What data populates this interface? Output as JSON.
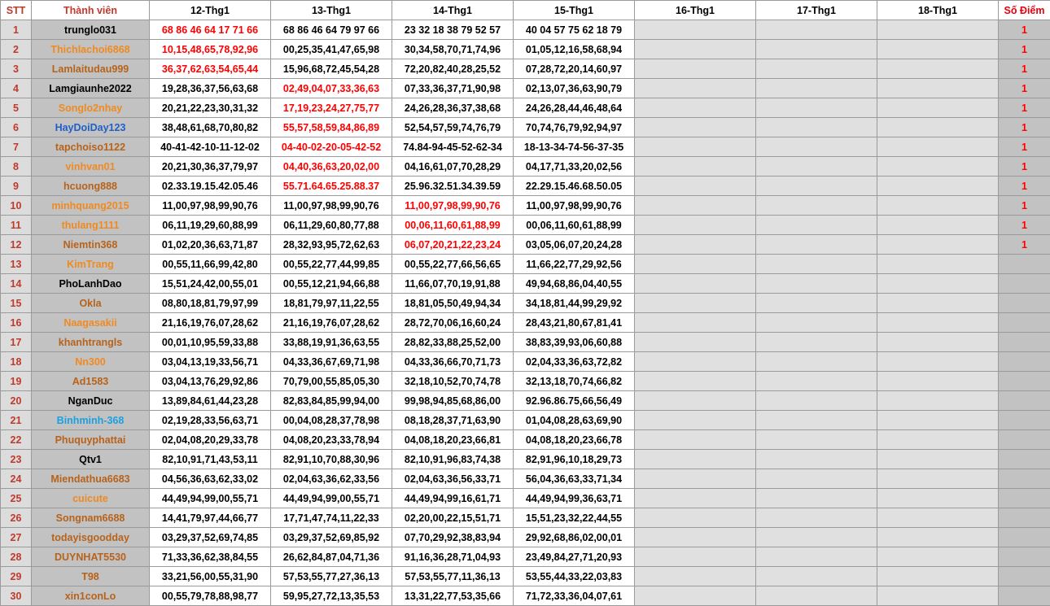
{
  "headers": {
    "stt": "STT",
    "member": "Thành viên",
    "days": [
      "12-Thg1",
      "13-Thg1",
      "14-Thg1",
      "15-Thg1",
      "16-Thg1",
      "17-Thg1",
      "18-Thg1"
    ],
    "score": "Số Điểm"
  },
  "colors": {
    "header_red": "#c0392b",
    "highlight_red": "#ff0000",
    "orange_name": "#f08a20",
    "brown_name": "#b8621a",
    "blue_name": "#2060c8",
    "lightblue_name": "#1aa0e0",
    "member_bg": "#c2c2c2",
    "empty_bg": "#e0e0e0"
  },
  "rows": [
    {
      "stt": "1",
      "member": "trunglo031",
      "name_color": "#000000",
      "days": [
        "68 86 46 64 17 71 66",
        "68 86 46 64 79 97 66",
        "23 32 18 38 79 52 57",
        "40 04 57 75 62 18 79",
        "",
        "",
        ""
      ],
      "win_day": 0,
      "score": "1"
    },
    {
      "stt": "2",
      "member": "Thichlachoi6868",
      "name_color": "#f08a20",
      "days": [
        "10,15,48,65,78,92,96",
        "00,25,35,41,47,65,98",
        "30,34,58,70,71,74,96",
        "01,05,12,16,58,68,94",
        "",
        "",
        ""
      ],
      "win_day": 0,
      "score": "1"
    },
    {
      "stt": "3",
      "member": "Lamlaitudau999",
      "name_color": "#b8621a",
      "days": [
        "36,37,62,63,54,65,44",
        "15,96,68,72,45,54,28",
        "72,20,82,40,28,25,52",
        "07,28,72,20,14,60,97",
        "",
        "",
        ""
      ],
      "win_day": 0,
      "score": "1"
    },
    {
      "stt": "4",
      "member": "Lamgiaunhe2022",
      "name_color": "#000000",
      "days": [
        "19,28,36,37,56,63,68",
        "02,49,04,07,33,36,63",
        "07,33,36,37,71,90,98",
        "02,13,07,36,63,90,79",
        "",
        "",
        ""
      ],
      "win_day": 1,
      "score": "1"
    },
    {
      "stt": "5",
      "member": "Songlo2nhay",
      "name_color": "#f08a20",
      "days": [
        "20,21,22,23,30,31,32",
        "17,19,23,24,27,75,77",
        "24,26,28,36,37,38,68",
        "24,26,28,44,46,48,64",
        "",
        "",
        ""
      ],
      "win_day": 1,
      "score": "1"
    },
    {
      "stt": "6",
      "member": "HayDoiDay123",
      "name_color": "#2060c8",
      "days": [
        "38,48,61,68,70,80,82",
        "55,57,58,59,84,86,89",
        "52,54,57,59,74,76,79",
        "70,74,76,79,92,94,97",
        "",
        "",
        ""
      ],
      "win_day": 1,
      "score": "1"
    },
    {
      "stt": "7",
      "member": "tapchoiso1122",
      "name_color": "#b8621a",
      "days": [
        "40-41-42-10-11-12-02",
        "04-40-02-20-05-42-52",
        "74.84-94-45-52-62-34",
        "18-13-34-74-56-37-35",
        "",
        "",
        ""
      ],
      "win_day": 1,
      "score": "1"
    },
    {
      "stt": "8",
      "member": "vinhvan01",
      "name_color": "#f08a20",
      "days": [
        "20,21,30,36,37,79,97",
        "04,40,36,63,20,02,00",
        "04,16,61,07,70,28,29",
        "04,17,71,33,20,02,56",
        "",
        "",
        ""
      ],
      "win_day": 1,
      "score": "1"
    },
    {
      "stt": "9",
      "member": "hcuong888",
      "name_color": "#b8621a",
      "days": [
        "02.33.19.15.42.05.46",
        "55.71.64.65.25.88.37",
        "25.96.32.51.34.39.59",
        "22.29.15.46.68.50.05",
        "",
        "",
        ""
      ],
      "win_day": 1,
      "score": "1"
    },
    {
      "stt": "10",
      "member": "minhquang2015",
      "name_color": "#f08a20",
      "days": [
        "11,00,97,98,99,90,76",
        "11,00,97,98,99,90,76",
        "11,00,97,98,99,90,76",
        "11,00,97,98,99,90,76",
        "",
        "",
        ""
      ],
      "win_day": 2,
      "score": "1"
    },
    {
      "stt": "11",
      "member": "thulang1111",
      "name_color": "#f08a20",
      "days": [
        "06,11,19,29,60,88,99",
        "06,11,29,60,80,77,88",
        "00,06,11,60,61,88,99",
        "00,06,11,60,61,88,99",
        "",
        "",
        ""
      ],
      "win_day": 2,
      "score": "1"
    },
    {
      "stt": "12",
      "member": "Niemtin368",
      "name_color": "#b8621a",
      "days": [
        "01,02,20,36,63,71,87",
        "28,32,93,95,72,62,63",
        "06,07,20,21,22,23,24",
        "03,05,06,07,20,24,28",
        "",
        "",
        ""
      ],
      "win_day": 2,
      "score": "1"
    },
    {
      "stt": "13",
      "member": "KimTrang",
      "name_color": "#f08a20",
      "days": [
        "00,55,11,66,99,42,80",
        "00,55,22,77,44,99,85",
        "00,55,22,77,66,56,65",
        "11,66,22,77,29,92,56",
        "",
        "",
        ""
      ],
      "win_day": -1,
      "score": ""
    },
    {
      "stt": "14",
      "member": "PhoLanhDao",
      "name_color": "#000000",
      "days": [
        "15,51,24,42,00,55,01",
        "00,55,12,21,94,66,88",
        "11,66,07,70,19,91,88",
        "49,94,68,86,04,40,55",
        "",
        "",
        ""
      ],
      "win_day": -1,
      "score": ""
    },
    {
      "stt": "15",
      "member": "Okla",
      "name_color": "#b8621a",
      "days": [
        "08,80,18,81,79,97,99",
        "18,81,79,97,11,22,55",
        "18,81,05,50,49,94,34",
        "34,18,81,44,99,29,92",
        "",
        "",
        ""
      ],
      "win_day": -1,
      "score": ""
    },
    {
      "stt": "16",
      "member": "Naagasakii",
      "name_color": "#f08a20",
      "days": [
        "21,16,19,76,07,28,62",
        "21,16,19,76,07,28,62",
        "28,72,70,06,16,60,24",
        "28,43,21,80,67,81,41",
        "",
        "",
        ""
      ],
      "win_day": -1,
      "score": ""
    },
    {
      "stt": "17",
      "member": "khanhtrangls",
      "name_color": "#b8621a",
      "days": [
        "00,01,10,95,59,33,88",
        "33,88,19,91,36,63,55",
        "28,82,33,88,25,52,00",
        "38,83,39,93,06,60,88",
        "",
        "",
        ""
      ],
      "win_day": -1,
      "score": ""
    },
    {
      "stt": "18",
      "member": "Nn300",
      "name_color": "#f08a20",
      "days": [
        "03,04,13,19,33,56,71",
        "04,33,36,67,69,71,98",
        "04,33,36,66,70,71,73",
        "02,04,33,36,63,72,82",
        "",
        "",
        ""
      ],
      "win_day": -1,
      "score": ""
    },
    {
      "stt": "19",
      "member": "Ad1583",
      "name_color": "#b8621a",
      "days": [
        "03,04,13,76,29,92,86",
        "70,79,00,55,85,05,30",
        "32,18,10,52,70,74,78",
        "32,13,18,70,74,66,82",
        "",
        "",
        ""
      ],
      "win_day": -1,
      "score": ""
    },
    {
      "stt": "20",
      "member": "NganDuc",
      "name_color": "#000000",
      "days": [
        "13,89,84,61,44,23,28",
        "82,83,84,85,99,94,00",
        "99,98,94,85,68,86,00",
        "92.96.86.75,66,56,49",
        "",
        "",
        ""
      ],
      "win_day": -1,
      "score": ""
    },
    {
      "stt": "21",
      "member": "Binhminh-368",
      "name_color": "#1aa0e0",
      "days": [
        "02,19,28,33,56,63,71",
        "00,04,08,28,37,78,98",
        "08,18,28,37,71,63,90",
        "01,04,08,28,63,69,90",
        "",
        "",
        ""
      ],
      "win_day": -1,
      "score": ""
    },
    {
      "stt": "22",
      "member": "Phuquyphattai",
      "name_color": "#b8621a",
      "days": [
        "02,04,08,20,29,33,78",
        "04,08,20,23,33,78,94",
        "04,08,18,20,23,66,81",
        "04,08,18,20,23,66,78",
        "",
        "",
        ""
      ],
      "win_day": -1,
      "score": ""
    },
    {
      "stt": "23",
      "member": "Qtv1",
      "name_color": "#000000",
      "days": [
        "82,10,91,71,43,53,11",
        "82,91,10,70,88,30,96",
        "82,10,91,96,83,74,38",
        "82,91,96,10,18,29,73",
        "",
        "",
        ""
      ],
      "win_day": -1,
      "score": ""
    },
    {
      "stt": "24",
      "member": "Miendathua6683",
      "name_color": "#b8621a",
      "days": [
        "04,56,36,63,62,33,02",
        "02,04,63,36,62,33,56",
        "02,04,63,36,56,33,71",
        "56,04,36,63,33,71,34",
        "",
        "",
        ""
      ],
      "win_day": -1,
      "score": ""
    },
    {
      "stt": "25",
      "member": "cuicute",
      "name_color": "#f08a20",
      "days": [
        "44,49,94,99,00,55,71",
        "44,49,94,99,00,55,71",
        "44,49,94,99,16,61,71",
        "44,49,94,99,36,63,71",
        "",
        "",
        ""
      ],
      "win_day": -1,
      "score": ""
    },
    {
      "stt": "26",
      "member": "Songnam6688",
      "name_color": "#b8621a",
      "days": [
        "14,41,79,97,44,66,77",
        "17,71,47,74,11,22,33",
        "02,20,00,22,15,51,71",
        "15,51,23,32,22,44,55",
        "",
        "",
        ""
      ],
      "win_day": -1,
      "score": ""
    },
    {
      "stt": "27",
      "member": "todayisgoodday",
      "name_color": "#b8621a",
      "days": [
        "03,29,37,52,69,74,85",
        "03,29,37,52,69,85,92",
        "07,70,29,92,38,83,94",
        "29,92,68,86,02,00,01",
        "",
        "",
        ""
      ],
      "win_day": -1,
      "score": ""
    },
    {
      "stt": "28",
      "member": "DUYNHAT5530",
      "name_color": "#b8621a",
      "days": [
        "71,33,36,62,38,84,55",
        "26,62,84,87,04,71,36",
        "91,16,36,28,71,04,93",
        "23,49,84,27,71,20,93",
        "",
        "",
        ""
      ],
      "win_day": -1,
      "score": ""
    },
    {
      "stt": "29",
      "member": "T98",
      "name_color": "#b8621a",
      "days": [
        "33,21,56,00,55,31,90",
        "57,53,55,77,27,36,13",
        "57,53,55,77,11,36,13",
        "53,55,44,33,22,03,83",
        "",
        "",
        ""
      ],
      "win_day": -1,
      "score": ""
    },
    {
      "stt": "30",
      "member": "xin1conLo",
      "name_color": "#b8621a",
      "days": [
        "00,55,79,78,88,98,77",
        "59,95,27,72,13,35,53",
        "13,31,22,77,53,35,66",
        "71,72,33,36,04,07,61",
        "",
        "",
        ""
      ],
      "win_day": -1,
      "score": ""
    }
  ]
}
